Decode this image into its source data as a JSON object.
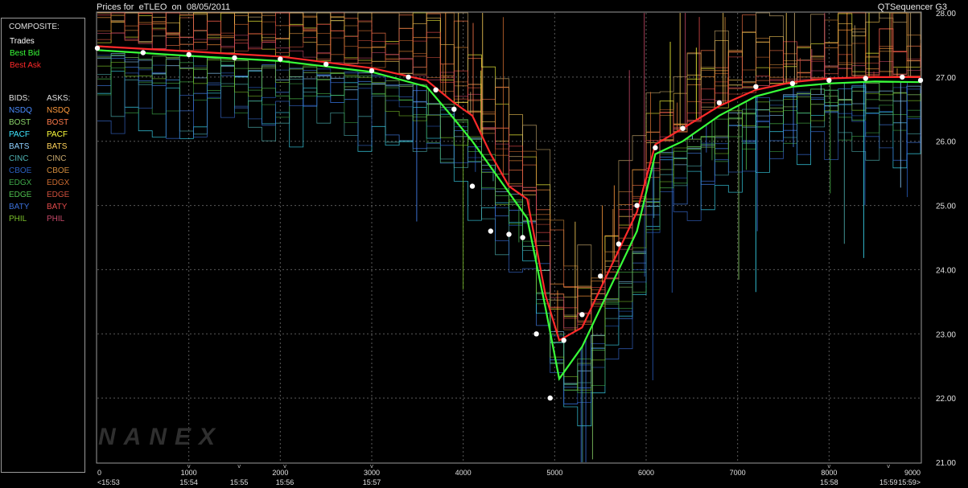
{
  "header": {
    "title": "Prices for  eTLEO  on  08/05/2011",
    "brand": "QTSequencer G3"
  },
  "legend": {
    "composite_label": "COMPOSITE:",
    "composite": [
      {
        "label": "Trades",
        "color": "#ffffff"
      },
      {
        "label": "Best Bid",
        "color": "#39ff39"
      },
      {
        "label": "Best Ask",
        "color": "#ff2a2a"
      }
    ],
    "bids_label": "BIDS:",
    "asks_label": "ASKS:",
    "exchanges": [
      {
        "bid": "NSDQ",
        "ask": "NSDQ",
        "bid_color": "#4a8cff",
        "ask_color": "#ff9a3c"
      },
      {
        "bid": "BOST",
        "ask": "BOST",
        "bid_color": "#8cd66b",
        "ask_color": "#ff7a4a"
      },
      {
        "bid": "PACF",
        "ask": "PACF",
        "bid_color": "#3ee6ff",
        "ask_color": "#ffff3c"
      },
      {
        "bid": "BATS",
        "ask": "BATS",
        "bid_color": "#8ed0ff",
        "ask_color": "#ffd25a"
      },
      {
        "bid": "CINC",
        "ask": "CINC",
        "bid_color": "#4fb3b3",
        "ask_color": "#c8a96e"
      },
      {
        "bid": "CBOE",
        "ask": "CBOE",
        "bid_color": "#2a5fbf",
        "ask_color": "#d08a3c"
      },
      {
        "bid": "EDGX",
        "ask": "EDGX",
        "bid_color": "#3fa84a",
        "ask_color": "#c96a30"
      },
      {
        "bid": "EDGE",
        "ask": "EDGE",
        "bid_color": "#4fbf4f",
        "ask_color": "#d0503c"
      },
      {
        "bid": "BATY",
        "ask": "BATY",
        "bid_color": "#3a6fd8",
        "ask_color": "#e04a4a"
      },
      {
        "bid": "PHIL",
        "ask": "PHIL",
        "bid_color": "#7abf2a",
        "ask_color": "#c84a6a"
      }
    ]
  },
  "watermark": "NANEX",
  "chart_data": {
    "type": "line",
    "title": "Prices for  eTLEO  on  08/05/2011",
    "xlim": [
      0,
      9000
    ],
    "ylim": [
      21.0,
      28.0
    ],
    "x_ticks": [
      0,
      1000,
      2000,
      3000,
      4000,
      5000,
      6000,
      7000,
      8000,
      9000
    ],
    "x_tick_labels": [
      "0",
      "1000",
      "2000",
      "3000",
      "4000",
      "5000",
      "6000",
      "7000",
      "8000",
      "9000"
    ],
    "time_ticks": [
      {
        "x": 0,
        "label": "<15:53"
      },
      {
        "x": 1000,
        "label": "15:54"
      },
      {
        "x": 1550,
        "label": "15:55"
      },
      {
        "x": 2050,
        "label": "15:56"
      },
      {
        "x": 3000,
        "label": "15:57"
      },
      {
        "x": 8000,
        "label": "15:58"
      },
      {
        "x": 8650,
        "label": "15:59"
      },
      {
        "x": 9000,
        "label": "15:59>"
      }
    ],
    "y_ticks": [
      21.0,
      22.0,
      23.0,
      24.0,
      25.0,
      26.0,
      27.0,
      28.0
    ],
    "y_tick_labels": [
      "21.00",
      "22.00",
      "23.00",
      "24.00",
      "25.00",
      "26.00",
      "27.00",
      "28.00"
    ],
    "grid": true,
    "series": [
      {
        "name": "Trades",
        "color": "#ffffff",
        "x": [
          0,
          500,
          1000,
          1500,
          2000,
          2500,
          3000,
          3400,
          3700,
          3900,
          4100,
          4300,
          4500,
          4650,
          4800,
          4950,
          5100,
          5300,
          5500,
          5700,
          5900,
          6100,
          6400,
          6800,
          7200,
          7600,
          8000,
          8400,
          8800,
          9000
        ],
        "y": [
          27.45,
          27.38,
          27.35,
          27.3,
          27.28,
          27.2,
          27.1,
          27.0,
          26.8,
          26.5,
          25.3,
          24.6,
          24.55,
          24.5,
          23.0,
          22.0,
          22.9,
          23.3,
          23.9,
          24.4,
          25.0,
          25.9,
          26.2,
          26.6,
          26.85,
          26.9,
          26.95,
          26.98,
          27.0,
          26.95
        ]
      },
      {
        "name": "Best Bid",
        "color": "#39ff39",
        "x": [
          0,
          1000,
          2000,
          3000,
          3600,
          3900,
          4100,
          4300,
          4500,
          4700,
          4900,
          5050,
          5300,
          5600,
          5900,
          6100,
          6400,
          6800,
          7200,
          7600,
          8000,
          8500,
          9000
        ],
        "y": [
          27.42,
          27.33,
          27.25,
          27.08,
          26.85,
          26.35,
          26.0,
          25.6,
          25.2,
          24.8,
          23.4,
          22.3,
          22.8,
          23.7,
          24.6,
          25.8,
          26.0,
          26.4,
          26.7,
          26.85,
          26.9,
          26.93,
          26.92
        ]
      },
      {
        "name": "Best Ask",
        "color": "#ff2a2a",
        "x": [
          0,
          1000,
          2000,
          3000,
          3600,
          3900,
          4100,
          4300,
          4500,
          4700,
          4900,
          5050,
          5300,
          5600,
          5900,
          6100,
          6400,
          6800,
          7200,
          7600,
          8000,
          8500,
          9000
        ],
        "y": [
          27.48,
          27.4,
          27.32,
          27.14,
          26.95,
          26.6,
          26.4,
          25.8,
          25.3,
          25.1,
          23.6,
          22.9,
          23.1,
          24.0,
          24.9,
          25.95,
          26.2,
          26.55,
          26.8,
          26.92,
          26.98,
          27.0,
          27.0
        ]
      }
    ]
  }
}
